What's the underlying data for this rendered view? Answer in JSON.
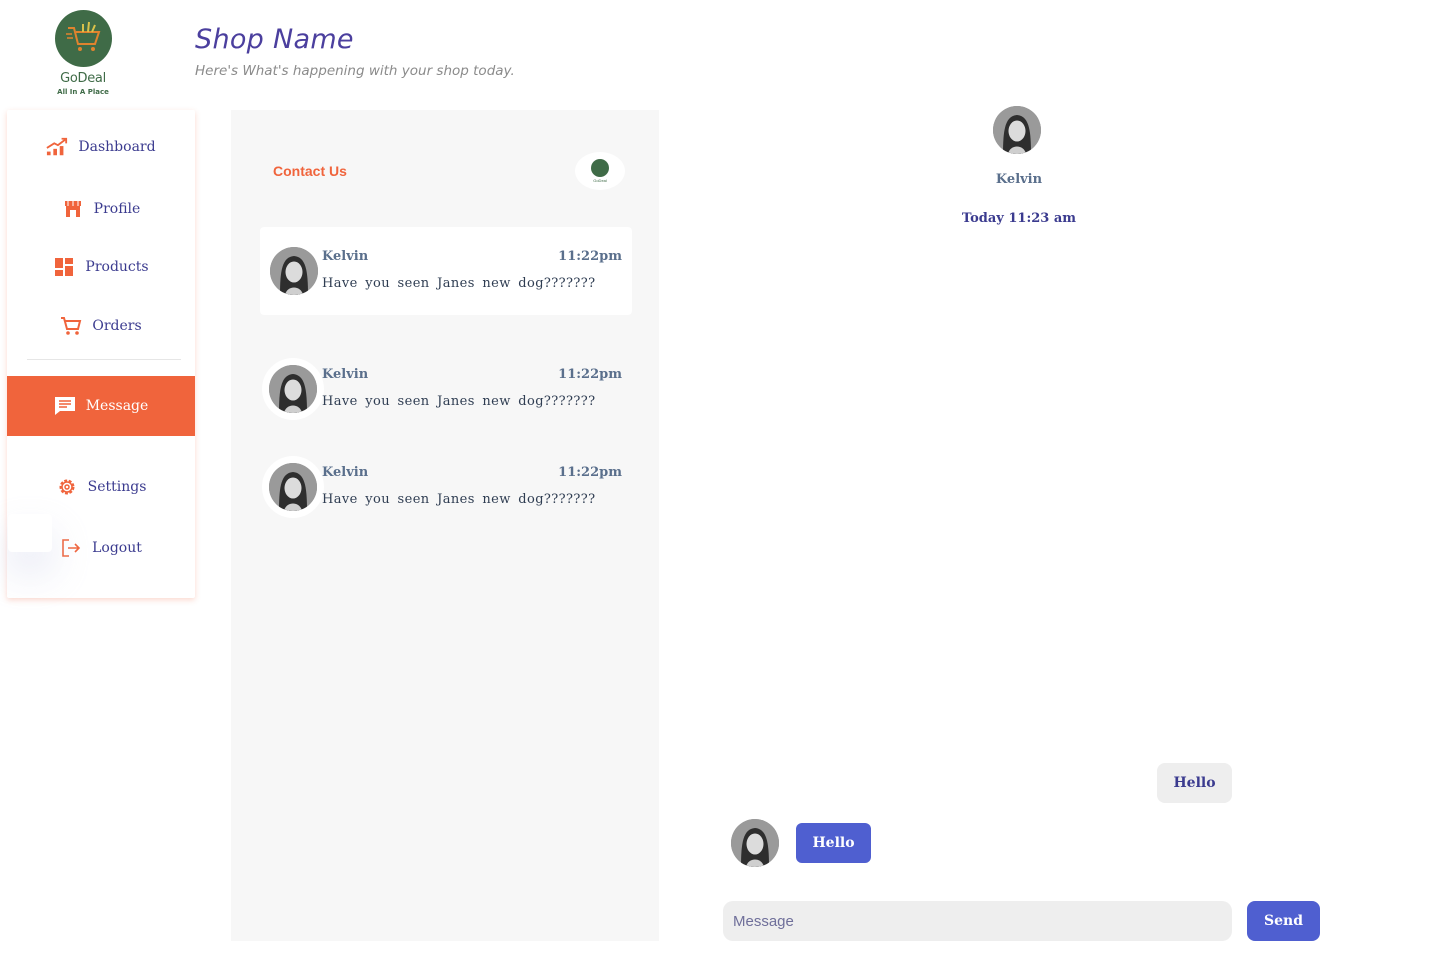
{
  "brand": {
    "name": "GoDeal",
    "tagline": "All In A Place"
  },
  "header": {
    "title": "Shop Name",
    "subtitle": "Here's  What's happening with your shop today."
  },
  "sidebar": {
    "items": [
      {
        "label": "Dashboard",
        "icon": "chart-up-icon",
        "active": false
      },
      {
        "label": "Profile",
        "icon": "store-icon",
        "active": false
      },
      {
        "label": "Products",
        "icon": "grid-icon",
        "active": false
      },
      {
        "label": "Orders",
        "icon": "cart-icon",
        "active": false
      },
      {
        "label": "Message",
        "icon": "chat-icon",
        "active": true
      },
      {
        "label": "Settings",
        "icon": "gear-icon",
        "active": false
      },
      {
        "label": "Logout",
        "icon": "logout-icon",
        "active": false
      }
    ]
  },
  "contacts": {
    "title": "Contact Us",
    "messages": [
      {
        "name": "Kelvin",
        "time": "11:22pm",
        "text": "Have you seen Janes new dog???????"
      },
      {
        "name": "Kelvin",
        "time": "11:22pm",
        "text": "Have you seen Janes new dog???????"
      },
      {
        "name": "Kelvin",
        "time": "11:22pm",
        "text": "Have you seen Janes new dog???????"
      }
    ]
  },
  "chat": {
    "name": "Kelvin",
    "date": "Today 11:23 am",
    "incoming": "Hello",
    "outgoing": "Hello",
    "input_placeholder": "Message",
    "send_label": "Send"
  },
  "colors": {
    "accent": "#f0643c",
    "primary": "#4f5fd0",
    "text": "#3b3b8f",
    "brand_green": "#3f6b47"
  }
}
